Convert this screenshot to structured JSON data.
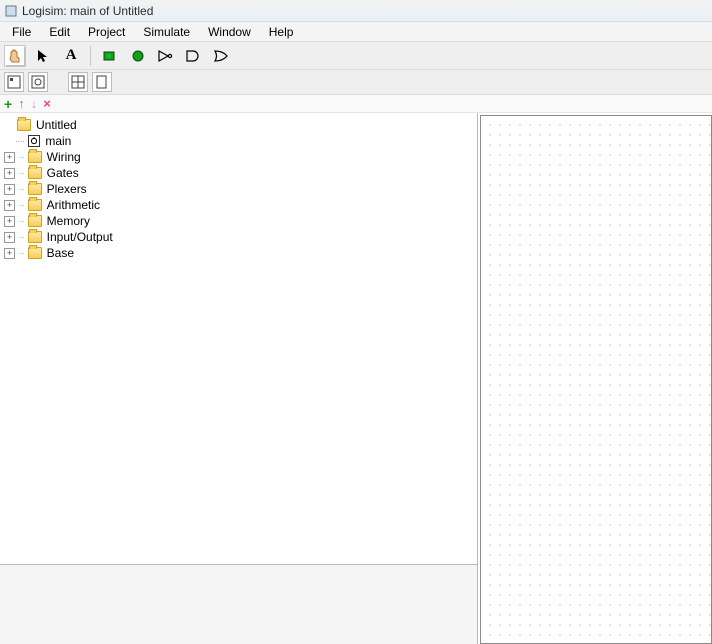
{
  "title": "Logisim: main of Untitled",
  "menu": [
    "File",
    "Edit",
    "Project",
    "Simulate",
    "Window",
    "Help"
  ],
  "toolbar": {
    "poke": "poke-tool",
    "select": "select-tool",
    "text_tool_letter": "A",
    "pin_in": "input-pin",
    "pin_out": "output-pin",
    "not": "not-gate",
    "and": "and-gate",
    "or": "or-gate"
  },
  "actions": {
    "add": "+",
    "up": "↑",
    "down": "↓",
    "delete": "×"
  },
  "tree": {
    "root": "Untitled",
    "circuit": "main",
    "libs": [
      "Wiring",
      "Gates",
      "Plexers",
      "Arithmetic",
      "Memory",
      "Input/Output",
      "Base"
    ]
  }
}
